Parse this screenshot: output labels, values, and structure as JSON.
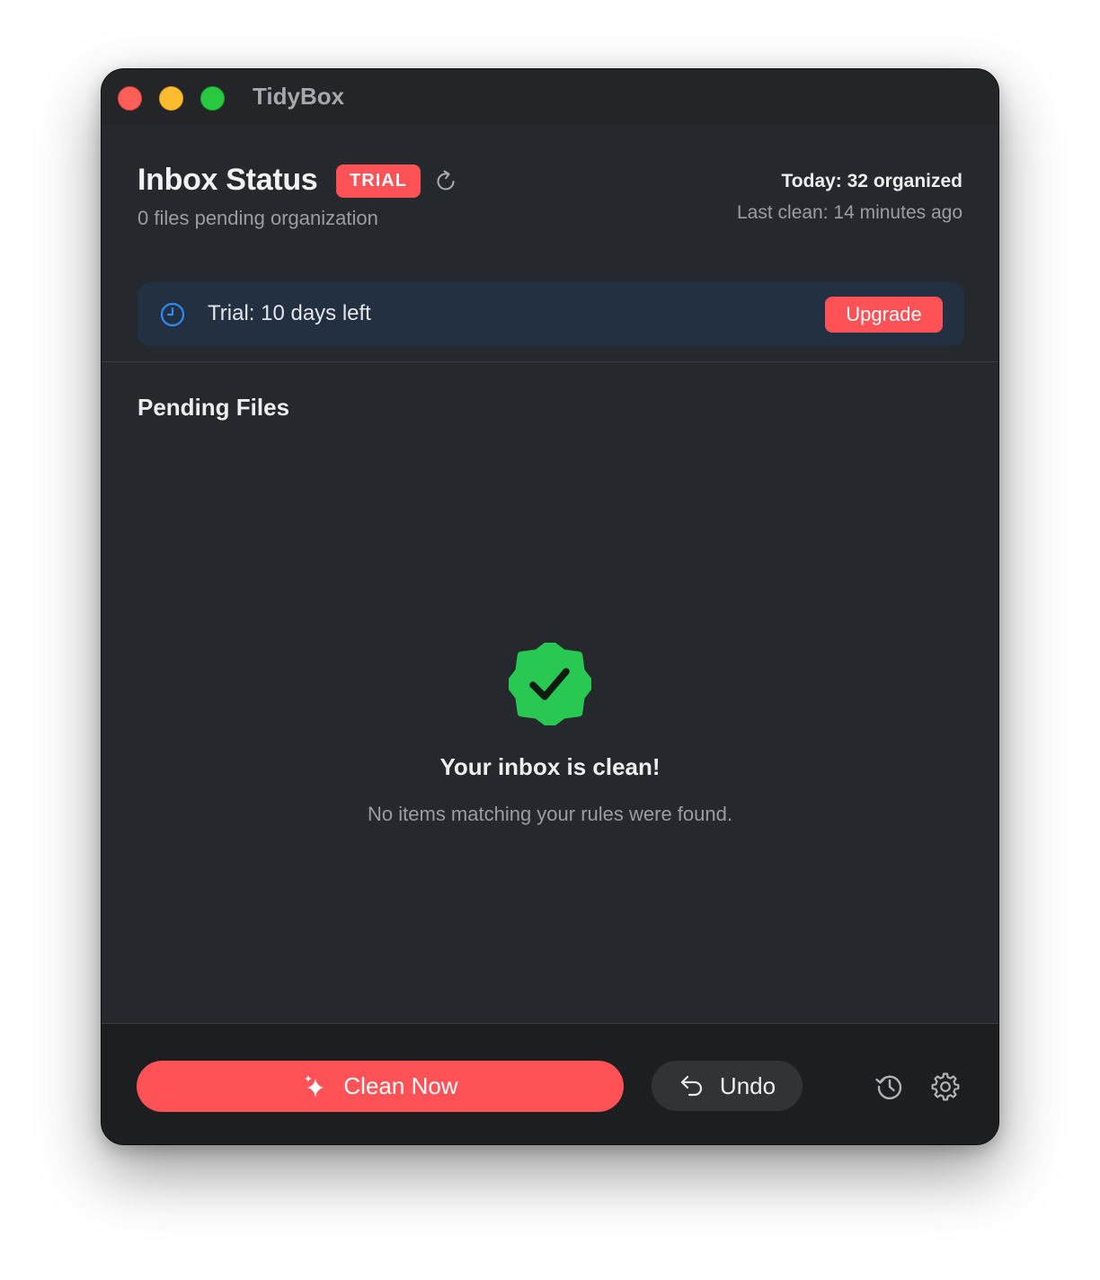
{
  "window": {
    "title": "TidyBox"
  },
  "header": {
    "title": "Inbox Status",
    "badge": "TRIAL",
    "pending_text": "0 files pending organization",
    "today_stat": "Today: 32 organized",
    "last_clean": "Last clean: 14 minutes ago",
    "refresh_icon": "refresh-icon"
  },
  "trial_banner": {
    "icon": "clock-icon",
    "text": "Trial: 10 days left",
    "upgrade_label": "Upgrade"
  },
  "pending_section": {
    "title": "Pending Files",
    "empty_state": {
      "icon": "verified-badge-icon",
      "title": "Your inbox is clean!",
      "subtitle": "No items matching your rules were found."
    }
  },
  "footer": {
    "clean_label": "Clean Now",
    "clean_icon": "sparkles-icon",
    "undo_label": "Undo",
    "undo_icon": "undo-arrow-icon",
    "history_icon": "history-icon",
    "settings_icon": "gear-icon"
  },
  "colors": {
    "accent": "#ff5257",
    "success": "#28c853",
    "info": "#2f8cf5",
    "window_bg": "#25282c",
    "banner_bg": "#223041"
  }
}
